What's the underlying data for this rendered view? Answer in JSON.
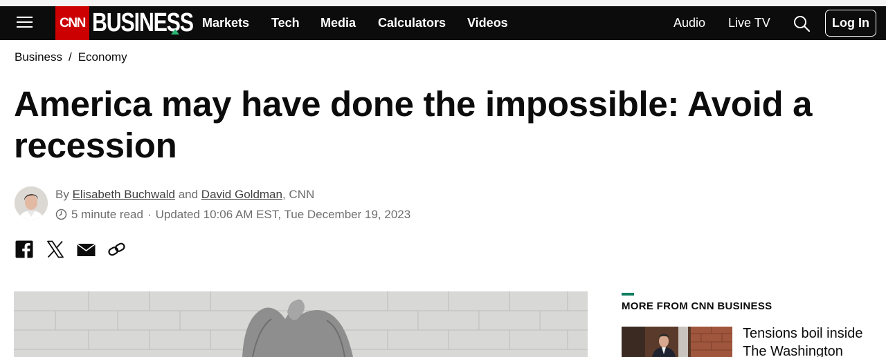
{
  "header": {
    "logo_text": "CNN",
    "section_word": "BUSINESS",
    "nav": [
      "Markets",
      "Tech",
      "Media",
      "Calculators",
      "Videos"
    ],
    "right": [
      "Audio",
      "Live TV"
    ],
    "login_label": "Log In",
    "brand_colors": {
      "cnn_red": "#cc0000",
      "accent_green": "#2bb673"
    }
  },
  "breadcrumb": {
    "first": "Business",
    "separator": "/",
    "second": "Economy"
  },
  "article": {
    "headline": "America may have done the impossible: Avoid a recession",
    "byline": {
      "prefix": "By",
      "author1": "Elisabeth Buchwald",
      "conjunction": "and",
      "author2": "David Goldman",
      "source": ", CNN"
    },
    "read_time": "5 minute read",
    "separator": "·",
    "updated": "Updated 10:06 AM EST, Tue December 19, 2023",
    "share_icons": [
      "facebook-icon",
      "x-icon",
      "email-icon",
      "link-icon"
    ]
  },
  "sidebar": {
    "title": "MORE FROM CNN BUSINESS",
    "accent_color": "#0f7d5f",
    "items": [
      {
        "headline": "Tensions boil inside The Washington"
      }
    ]
  }
}
